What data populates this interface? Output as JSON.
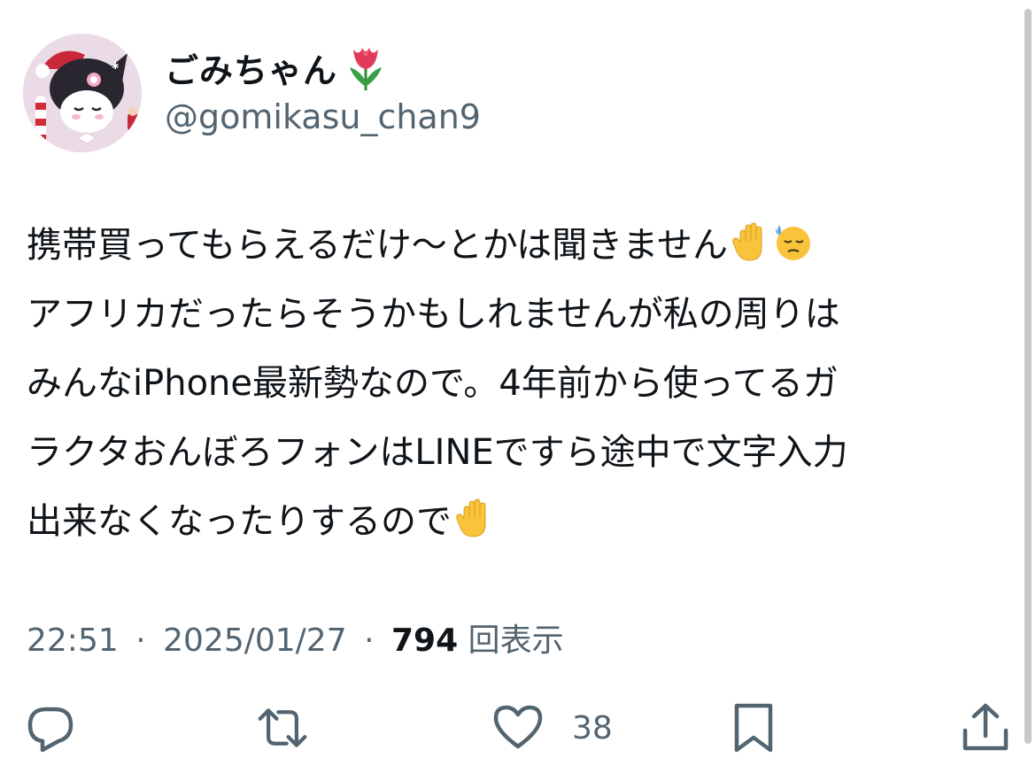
{
  "user": {
    "display_name": "ごみちゃん",
    "handle": "@gomikasu_chan9",
    "name_emoji": "tulip-emoji"
  },
  "tweet": {
    "lines": [
      "携帯買ってもらえるだけ〜とかは聞きません",
      "アフリカだったらそうかもしれませんが私の周りは",
      "みんなiPhone最新勢なので。4年前から使ってるガ",
      "ラクタおんぼろフォンはLINEですら途中で文字入力",
      "出来なくなったりするので"
    ],
    "line1_emojis": [
      "raised-hand-emoji",
      "downcast-sweat-face-emoji"
    ],
    "line5_emojis": [
      "raised-hand-emoji"
    ]
  },
  "meta": {
    "time": "22:51",
    "date": "2025/01/27",
    "separator": "·",
    "views_count": "794",
    "views_label": "回表示"
  },
  "actions": {
    "reply_icon": "reply-icon",
    "retweet_icon": "retweet-icon",
    "like_icon": "heart-icon",
    "like_count": "38",
    "bookmark_icon": "bookmark-icon",
    "share_icon": "share-icon"
  },
  "colors": {
    "text_primary": "#0f1419",
    "text_secondary": "#536471",
    "icon": "#536471"
  }
}
